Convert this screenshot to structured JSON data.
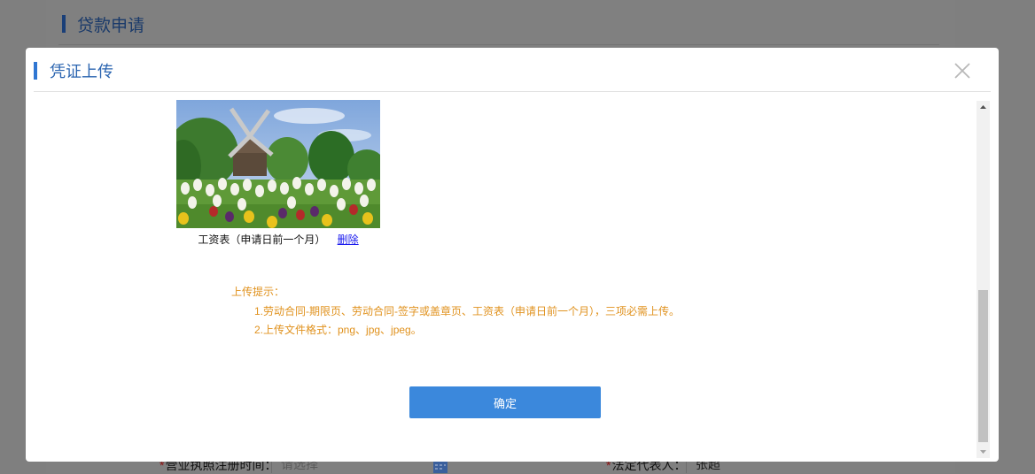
{
  "background": {
    "title": "贷款申请",
    "fields": [
      {
        "label": "营业执照注册时间：",
        "required": "*",
        "placeholder": "请选择"
      },
      {
        "label": "法定代表人：",
        "required": "*",
        "value": "张超"
      }
    ]
  },
  "modal": {
    "title": "凭证上传",
    "close_label": "×",
    "attachment": {
      "image_icon": "windmill-tulips-photo",
      "caption": "工资表（申请日前一个月）",
      "delete_label": "删除"
    },
    "tips": {
      "heading": "上传提示：",
      "lines": [
        "1.劳动合同-期限页、劳动合同-签字或盖章页、工资表（申请日前一个月），三项必需上传。",
        "2.上传文件格式：png、jpg、jpeg。"
      ]
    },
    "confirm_label": "确定"
  },
  "colors": {
    "accent": "#3b88dc",
    "title_blue": "#2a64b0",
    "tip_orange": "#e0921e",
    "overlay": "#7f7f7f"
  }
}
